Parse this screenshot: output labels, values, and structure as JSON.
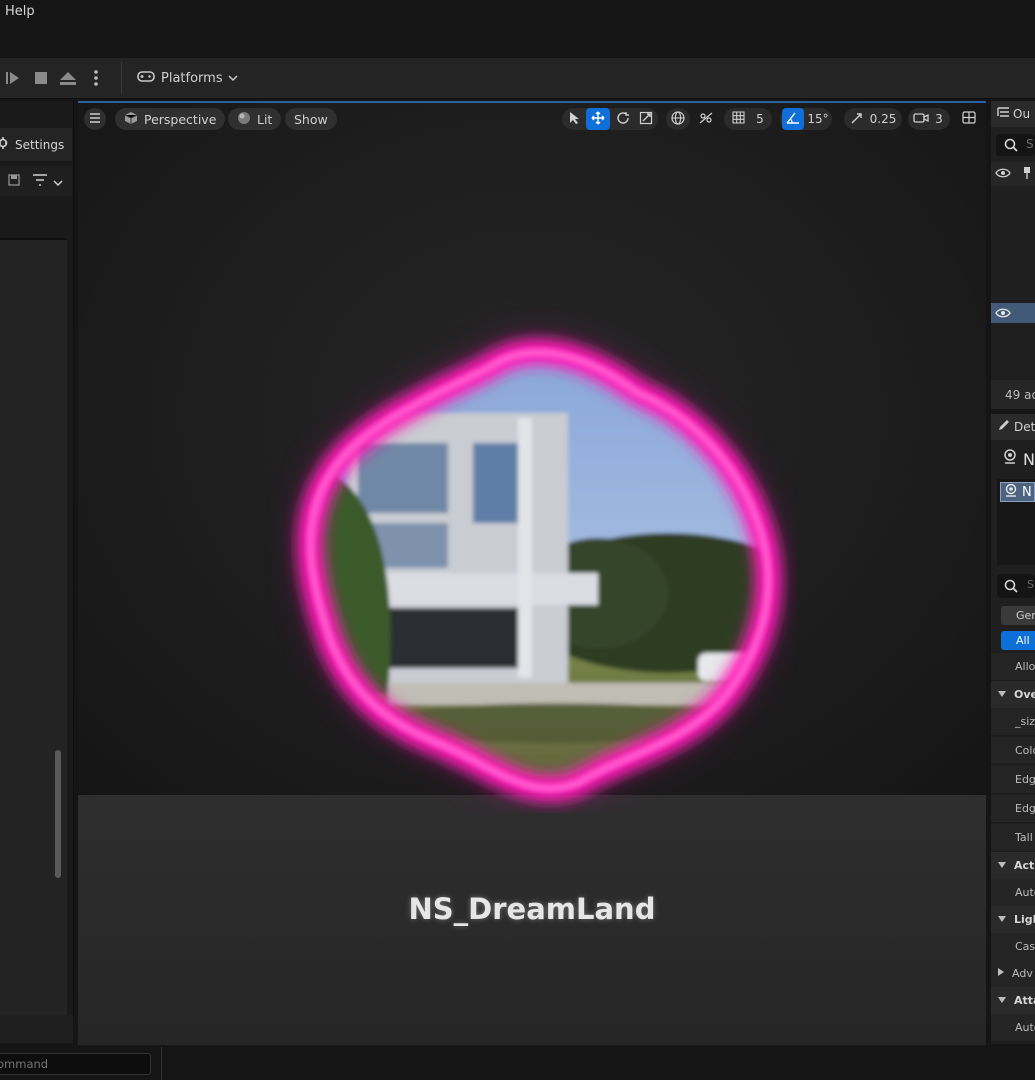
{
  "menu": {
    "help_label": "Help"
  },
  "toolbar": {
    "platforms_label": "Platforms"
  },
  "left_panel": {
    "settings_label": "Settings"
  },
  "viewport": {
    "perspective_label": "Perspective",
    "lit_label": "Lit",
    "show_label": "Show",
    "grid_snap_value": "5",
    "rotation_snap_value": "15°",
    "scale_snap_value": "0.25",
    "camera_speed_value": "3",
    "actor_label": "NS_DreamLand"
  },
  "outliner": {
    "tab_label": "Ou",
    "search_placeholder": "S",
    "status_text": "49 ac"
  },
  "details": {
    "tab_label": "Det",
    "selected_name": "N",
    "component_name": "N",
    "search_placeholder": "S",
    "filter_general": "Gen",
    "filter_all": "All",
    "rows": [
      {
        "label": "Allow",
        "type": "prop"
      },
      {
        "label": "Ove",
        "type": "cat"
      },
      {
        "label": "_siz",
        "type": "prop"
      },
      {
        "label": "Colo",
        "type": "prop"
      },
      {
        "label": "Edge",
        "type": "prop"
      },
      {
        "label": "Edge",
        "type": "prop"
      },
      {
        "label": "Tall",
        "type": "prop"
      },
      {
        "label": "Acti",
        "type": "cat"
      },
      {
        "label": "Auto",
        "type": "prop"
      },
      {
        "label": "Ligh",
        "type": "cat"
      },
      {
        "label": "Cast",
        "type": "prop"
      },
      {
        "label": "Adv",
        "type": "sub"
      },
      {
        "label": "Atta",
        "type": "cat"
      },
      {
        "label": "Auto",
        "type": "prop"
      }
    ]
  },
  "bottom": {
    "command_placeholder": "ommand"
  },
  "colors": {
    "accent_blue": "#0e6fd8",
    "portal_magenta": "#ff1fb8",
    "selection_row": "#425977"
  }
}
